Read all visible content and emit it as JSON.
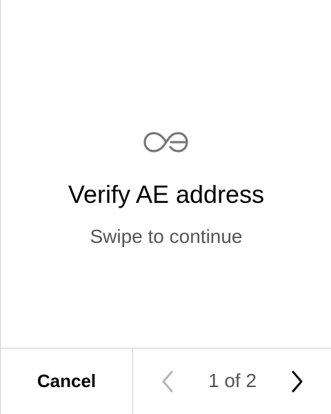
{
  "logo": {
    "icon": "aeternity-logo-icon",
    "color": "#777777"
  },
  "screen": {
    "title": "Verify AE address",
    "subtitle": "Swipe to continue"
  },
  "footer": {
    "cancel_label": "Cancel",
    "pager_text": "1 of 2",
    "prev_icon": "chevron-left-icon",
    "next_icon": "chevron-right-icon",
    "prev_color": "#b5b5b5",
    "next_color": "#000000"
  }
}
